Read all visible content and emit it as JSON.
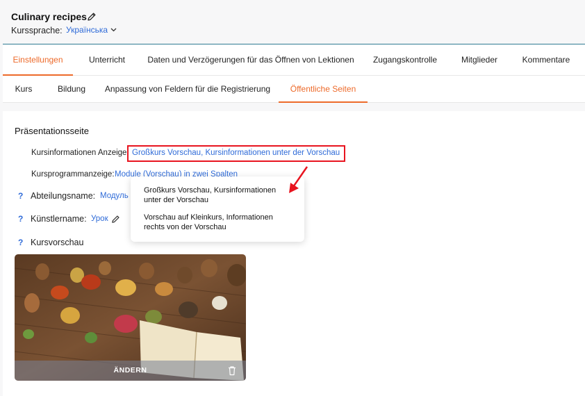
{
  "header": {
    "course_title": "Culinary recipes",
    "language_label": "Kurssprache:",
    "language_value": "Українська"
  },
  "main_tabs": [
    {
      "label": "Einstellungen",
      "active": true
    },
    {
      "label": "Unterricht",
      "active": false
    },
    {
      "label": "Daten und Verzögerungen für das Öffnen von Lektionen",
      "active": false
    },
    {
      "label": "Zugangskontrolle",
      "active": false
    },
    {
      "label": "Mitglieder",
      "active": false
    },
    {
      "label": "Kommentare",
      "active": false
    }
  ],
  "sub_tabs": [
    {
      "label": "Kurs",
      "active": false
    },
    {
      "label": "Bildung",
      "active": false
    },
    {
      "label": "Anpassung von Feldern für die Registrierung",
      "active": false
    },
    {
      "label": "Öffentliche Seiten",
      "active": true
    }
  ],
  "section": {
    "title": "Präsentationsseite",
    "info_display_label": "Kursinformationen Anzeige:",
    "info_display_value": "Großkurs Vorschau, Kursinformationen unter der Vorschau",
    "program_display_label": "Kursprogrammanzeige:",
    "program_display_value": "Module (Vorschau) in zwei Spalten",
    "department_label": "Abteilungsname:",
    "department_value": "Модуль",
    "artist_label": "Künstlername:",
    "artist_value": "Урок",
    "preview_label": "Kursvorschau",
    "help_symbol": "?"
  },
  "dropdown": {
    "options": [
      "Großkurs Vorschau, Kursinformationen unter der Vorschau",
      "Vorschau auf Kleinkurs, Informationen rechts von der Vorschau"
    ]
  },
  "preview": {
    "change_label": "ÄNDERN"
  },
  "colors": {
    "accent": "#ed6a2a",
    "link": "#2f6bd8",
    "highlight": "#e8141f"
  }
}
